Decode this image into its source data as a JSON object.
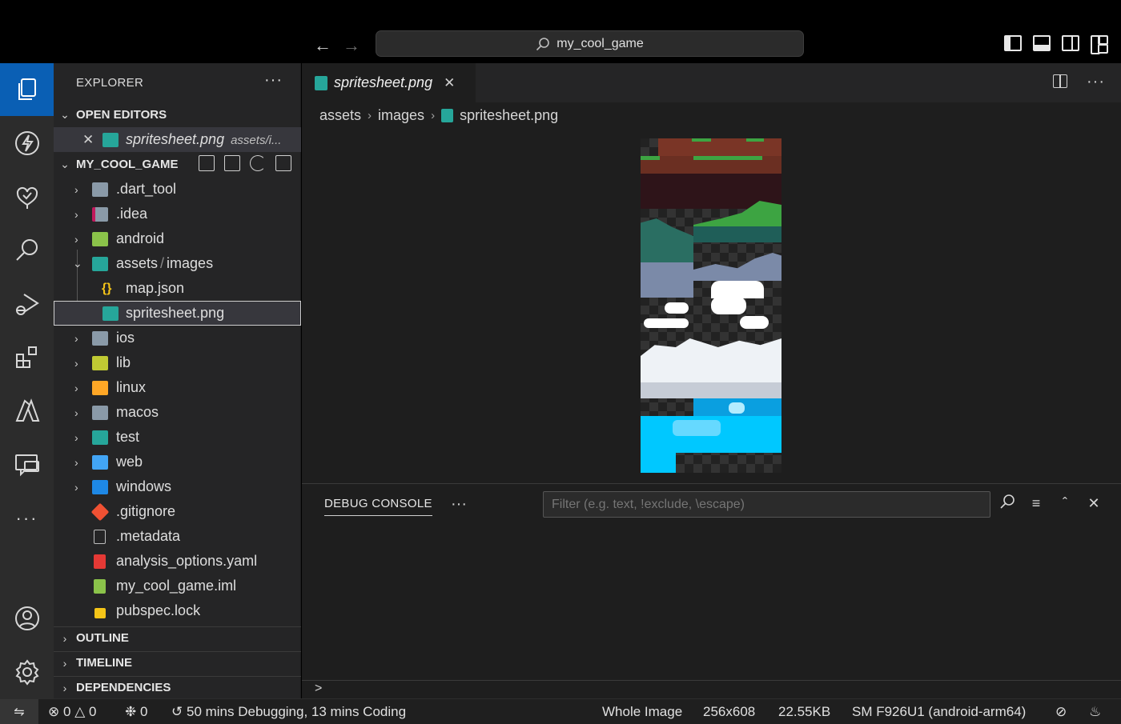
{
  "titlebar": {
    "back_icon": "arrow-left-icon",
    "forward_icon": "arrow-right-icon",
    "search_label": "my_cool_game"
  },
  "activity_bar": {
    "items": [
      "explorer",
      "flutter",
      "source-control",
      "search",
      "run-and-debug",
      "extensions",
      "azure",
      "remote-explorer",
      "more"
    ],
    "bottom": [
      "accounts",
      "manage"
    ],
    "more_label": "···"
  },
  "sidebar": {
    "title": "EXPLORER",
    "more_label": "···",
    "open_editors": {
      "title": "OPEN EDITORS",
      "items": [
        {
          "label": "spritesheet.png",
          "description": "assets/i..."
        }
      ]
    },
    "project": {
      "title": "MY_COOL_GAME",
      "rows": [
        {
          "label": ".dart_tool",
          "kind": "folder"
        },
        {
          "label": ".idea",
          "kind": "folder"
        },
        {
          "label": "android",
          "kind": "folder"
        },
        {
          "label": "assets",
          "label2": "images",
          "separator": "/",
          "kind": "folder-open"
        },
        {
          "label": "map.json",
          "kind": "file"
        },
        {
          "label": "spritesheet.png",
          "kind": "file"
        },
        {
          "label": "ios",
          "kind": "folder"
        },
        {
          "label": "lib",
          "kind": "folder"
        },
        {
          "label": "linux",
          "kind": "folder"
        },
        {
          "label": "macos",
          "kind": "folder"
        },
        {
          "label": "test",
          "kind": "folder"
        },
        {
          "label": "web",
          "kind": "folder"
        },
        {
          "label": "windows",
          "kind": "folder"
        },
        {
          "label": ".gitignore",
          "kind": "file"
        },
        {
          "label": ".metadata",
          "kind": "file"
        },
        {
          "label": "analysis_options.yaml",
          "kind": "file"
        },
        {
          "label": "my_cool_game.iml",
          "kind": "file"
        },
        {
          "label": "pubspec.lock",
          "kind": "file"
        }
      ]
    },
    "outline": "OUTLINE",
    "timeline": "TIMELINE",
    "dependencies": "DEPENDENCIES"
  },
  "editor": {
    "tab_label": "spritesheet.png",
    "breadcrumbs": [
      "assets",
      "images",
      "spritesheet.png"
    ],
    "more_label": "···"
  },
  "panel": {
    "tab_label": "DEBUG CONSOLE",
    "more_label": "···",
    "filter_placeholder": "Filter (e.g. text, !exclude, \\escape)",
    "prompt": ">"
  },
  "status": {
    "errors": "0",
    "warnings": "0",
    "ports": "0",
    "time": "50 mins Debugging, 13 mins Coding",
    "zoom": "Whole Image",
    "dimensions": "256x608",
    "size": "22.55KB",
    "device": "SM F926U1 (android-arm64)"
  },
  "colors": {
    "accent": "#0a5fb4",
    "png_icon": "#26a69a",
    "json_icon": "#f5c518",
    "git_icon": "#f05133",
    "yaml_icon": "#e53935",
    "lock_icon": "#f5c518",
    "iml_icon": "#8bc34a",
    "grass": "#3da442",
    "dirt": "#6b2f22",
    "water": "#00bfff",
    "mountain": "#2a6e62",
    "cloud": "#ffffff"
  }
}
